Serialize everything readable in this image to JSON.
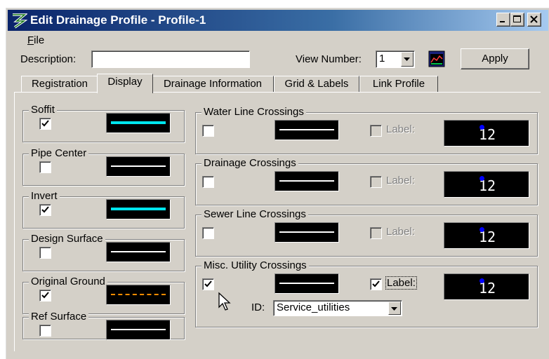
{
  "window": {
    "title": "Edit Drainage Profile - Profile-1",
    "controls": [
      "minimize-icon",
      "maximize-icon",
      "close-icon"
    ]
  },
  "menu": {
    "file_label": "File"
  },
  "toolbar": {
    "description_label": "Description:",
    "description_value": "",
    "view_number_label": "View Number:",
    "view_number_value": "1",
    "apply_label": "Apply"
  },
  "tabs": [
    {
      "label": "Registration",
      "active": false
    },
    {
      "label": "Display",
      "active": true
    },
    {
      "label": "Drainage Information",
      "active": false
    },
    {
      "label": "Grid & Labels",
      "active": false
    },
    {
      "label": "Link Profile",
      "active": false
    }
  ],
  "left_groups": [
    {
      "title": "Soffit",
      "checked": true,
      "line_color": "#00e5ee",
      "line_style": "thick"
    },
    {
      "title": "Pipe Center",
      "checked": false,
      "line_color": "#ffffff",
      "line_style": "solid"
    },
    {
      "title": "Invert",
      "checked": true,
      "line_color": "#00e5ee",
      "line_style": "thick"
    },
    {
      "title": "Design Surface",
      "checked": false,
      "line_color": "#ffffff",
      "line_style": "solid"
    },
    {
      "title": "Original Ground",
      "checked": true,
      "line_color": "#ff8c00",
      "line_style": "dashed"
    },
    {
      "title": "Ref Surface",
      "checked": false,
      "line_color": "#ffffff",
      "line_style": "solid"
    }
  ],
  "crossings": [
    {
      "title": "Water Line Crossings",
      "checked": false,
      "label_checked": false,
      "label_enabled": false,
      "label_text": "Label:",
      "preview_value": "12"
    },
    {
      "title": "Drainage Crossings",
      "checked": false,
      "label_checked": false,
      "label_enabled": false,
      "label_text": "Label:",
      "preview_value": "12"
    },
    {
      "title": "Sewer Line Crossings",
      "checked": false,
      "label_checked": false,
      "label_enabled": false,
      "label_text": "Label:",
      "preview_value": "12"
    },
    {
      "title": "Misc. Utility Crossings",
      "checked": true,
      "label_checked": true,
      "label_enabled": true,
      "label_text": "Label:",
      "preview_value": "12"
    }
  ],
  "misc_id": {
    "label": "ID:",
    "value": "Service_utilities"
  }
}
